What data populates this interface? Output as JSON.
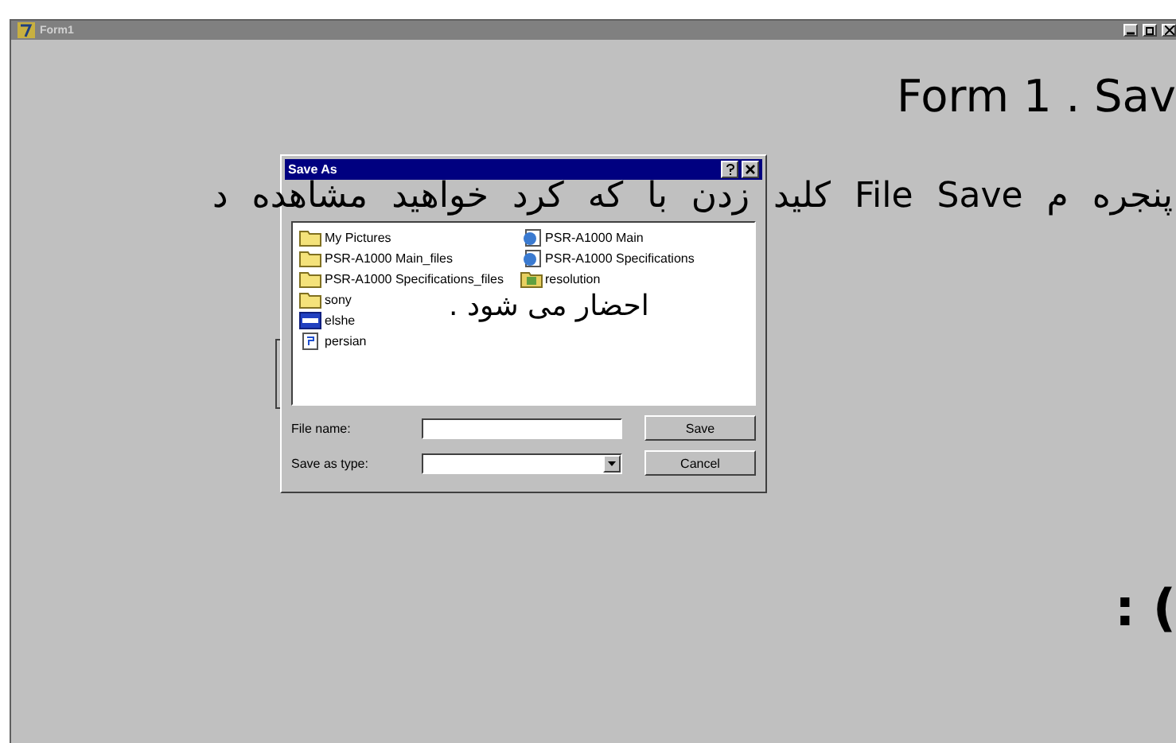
{
  "form": {
    "title": "Form1"
  },
  "dialog": {
    "title": "Save As",
    "files": [
      {
        "name": "My Pictures",
        "kind": "folder"
      },
      {
        "name": "PSR-A1000 Main_files",
        "kind": "folder"
      },
      {
        "name": "PSR-A1000 Specifications_files",
        "kind": "folder"
      },
      {
        "name": "sony",
        "kind": "folder"
      },
      {
        "name": "elshe",
        "kind": "image"
      },
      {
        "name": "persian",
        "kind": "document"
      },
      {
        "name": "PSR-A1000 Main",
        "kind": "web"
      },
      {
        "name": "PSR-A1000 Specifications",
        "kind": "web"
      },
      {
        "name": "resolution",
        "kind": "archive"
      }
    ],
    "file_name_label": "File name:",
    "save_type_label": "Save as type:",
    "buttons": [
      "Save",
      "Cancel"
    ]
  },
  "slide_texts": [
    {
      "kind": "heading",
      "text": "Form 1 . Sav"
    },
    {
      "kind": "line",
      "text": "پنجره م File Save کلید زدن با که کرد خواهید مشاهده د"
    },
    {
      "kind": "line",
      "text": "احضار می شود ."
    },
    {
      "kind": "big",
      "text": ": ("
    }
  ]
}
